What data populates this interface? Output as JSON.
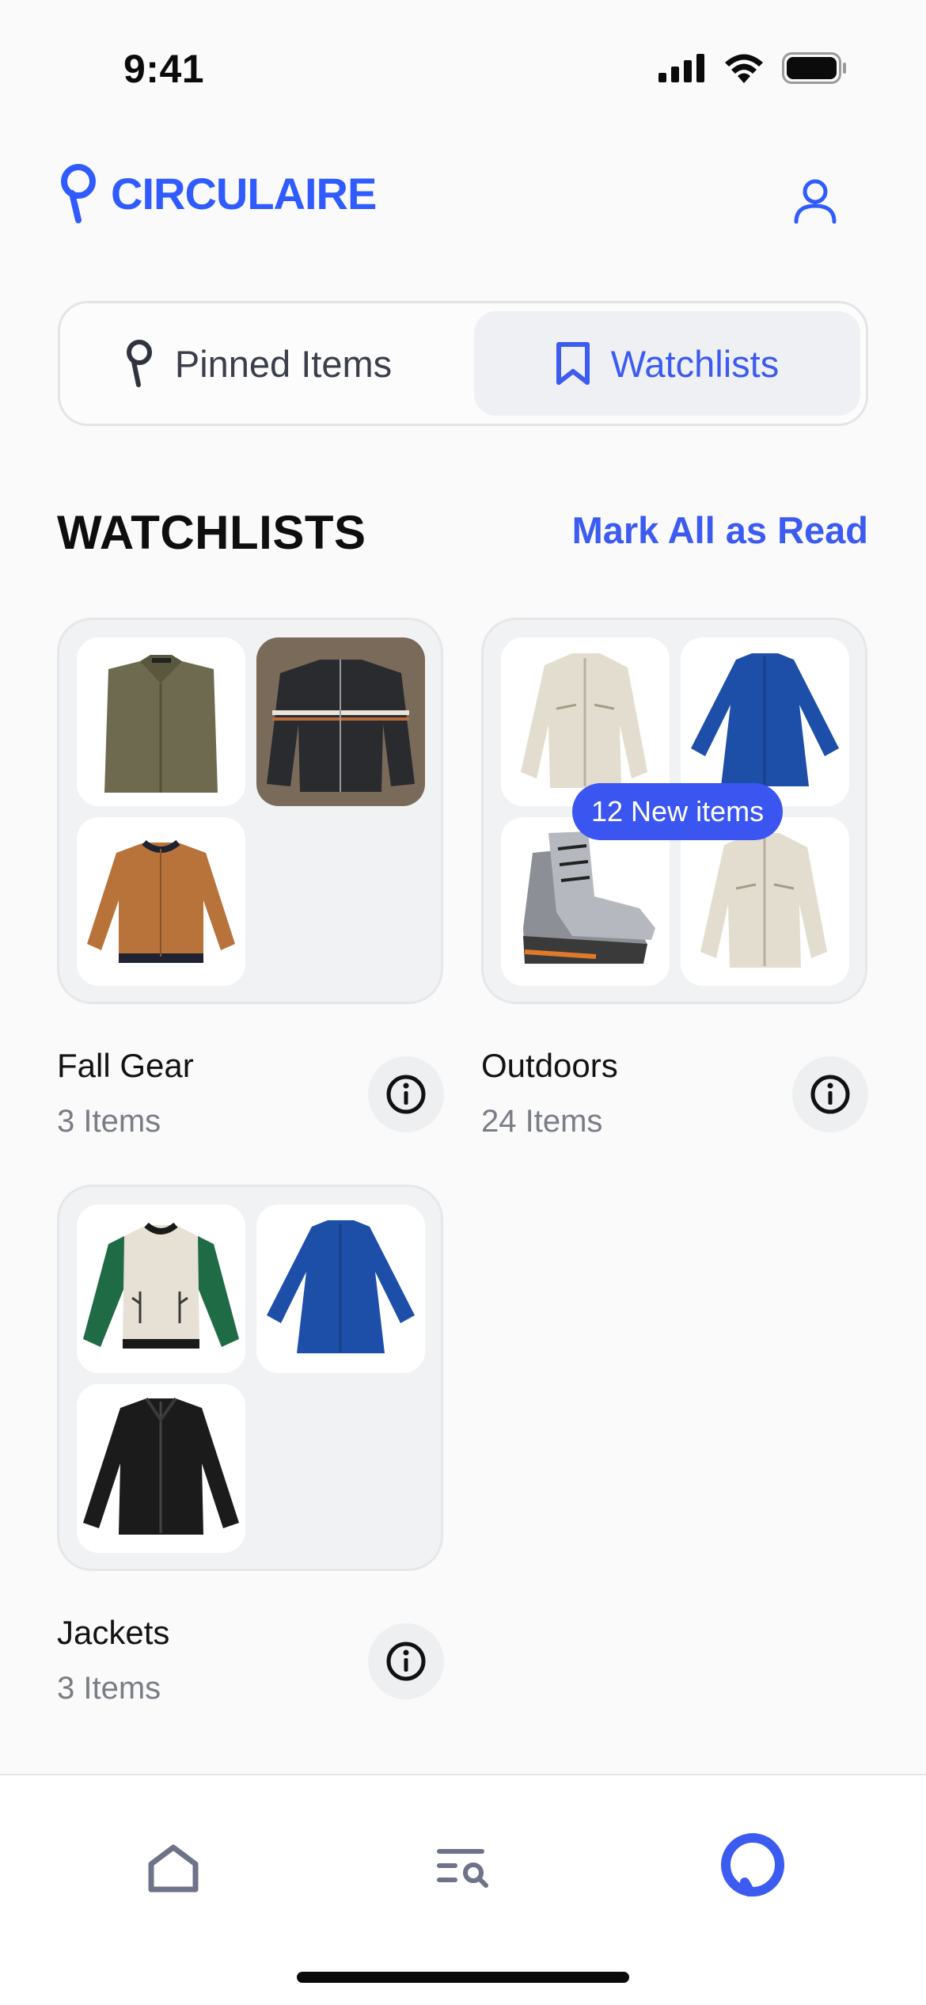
{
  "status_bar": {
    "time": "9:41"
  },
  "header": {
    "brand": "CIRCULAIRE",
    "profile_icon": "user-icon"
  },
  "colors": {
    "accent": "#3b5bf1",
    "badge": "#3b55f0",
    "card_bg": "#f1f2f4"
  },
  "segmented": {
    "pinned_label": "Pinned Items",
    "watchlists_label": "Watchlists",
    "selected": "Watchlists"
  },
  "section": {
    "title": "WATCHLISTS",
    "action": "Mark All as Read"
  },
  "watchlists": [
    {
      "name": "Fall Gear",
      "count": "3 Items",
      "thumbnails": [
        "olive-shirt",
        "leather-moto-jacket",
        "suede-bomber-jacket"
      ]
    },
    {
      "name": "Outdoors",
      "count": "24 Items",
      "badge": "12 New items",
      "thumbnails": [
        "beige-parka",
        "blue-coat",
        "hiking-boots",
        "beige-parka"
      ]
    },
    {
      "name": "Jackets",
      "count": "3 Items",
      "thumbnails": [
        "cactus-varsity-jacket",
        "blue-coat",
        "black-leather-jacket"
      ]
    }
  ],
  "tab_bar": {
    "items": [
      "home-icon",
      "search-list-icon",
      "circulaire-pin-icon"
    ],
    "active": "circulaire-pin-icon"
  }
}
